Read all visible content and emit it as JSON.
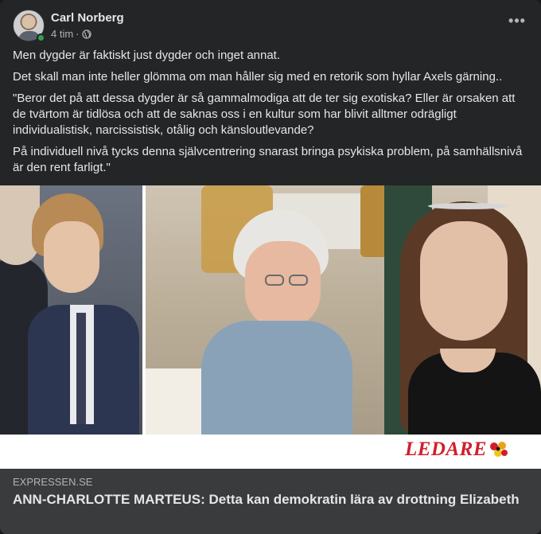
{
  "post": {
    "author": "Carl Norberg",
    "time": "4 tim",
    "separator": "·",
    "more_label": "•••",
    "paragraphs": [
      "Men dygder är faktiskt just dygder och inget annat.",
      "Det skall man inte heller glömma om man håller sig med en retorik som hyllar Axels gärning..",
      "\"Beror det på att dessa dygder är så gammalmodiga att de ter sig exotiska? Eller är orsaken att de tvärtom är tidlösa och att de saknas oss i en kultur som har blivit alltmer odrägligt individualistisk, narcissistisk, otålig och känsloutlevande?",
      "På individuell nivå tycks denna självcentrering snarast bringa psykiska problem, på samhällsnivå är den rent farligt.\""
    ]
  },
  "link": {
    "image_label": "LEDARE",
    "domain": "EXPRESSEN.SE",
    "title": "ANN-CHARLOTTE MARTEUS: Detta kan demokratin lära av drottning Elizabeth"
  },
  "colors": {
    "card_bg": "#242526",
    "link_bg": "#3a3b3c",
    "ledare_red": "#d11e2a",
    "online_green": "#31a24c"
  }
}
